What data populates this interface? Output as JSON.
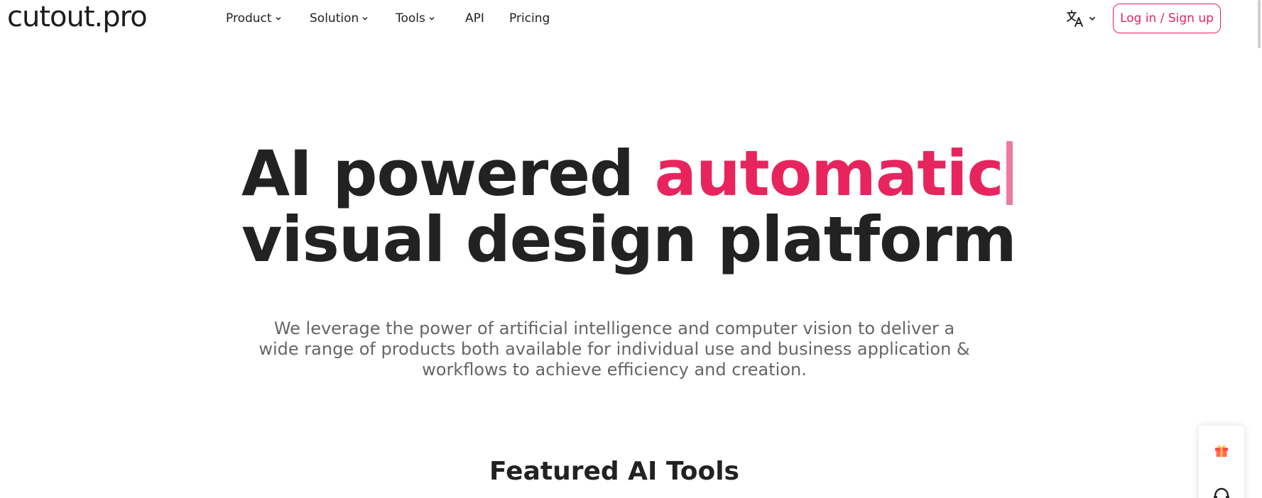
{
  "header": {
    "logo_text": "cutout.pro",
    "nav": [
      {
        "label": "Product",
        "has_dropdown": true
      },
      {
        "label": "Solution",
        "has_dropdown": true
      },
      {
        "label": "Tools",
        "has_dropdown": true
      },
      {
        "label": "API",
        "has_dropdown": false
      },
      {
        "label": "Pricing",
        "has_dropdown": false
      }
    ],
    "language_icon": "translate-icon",
    "login_label": "Log in / Sign up"
  },
  "hero": {
    "title_part1": "AI powered ",
    "title_accent": "automatic",
    "title_line2": "visual design platform",
    "subtitle": "We leverage the power of artificial intelligence and computer vision to deliver a wide range of products both available for individual use and business application & workflows to achieve efficiency and creation."
  },
  "featured": {
    "heading": "Featured AI Tools"
  },
  "side_widget": {
    "icons": [
      "gift-icon",
      "support-icon"
    ]
  },
  "colors": {
    "accent": "#e8245f",
    "text": "#222222",
    "subtext": "#666666",
    "cursor": "#ee7aa0"
  }
}
